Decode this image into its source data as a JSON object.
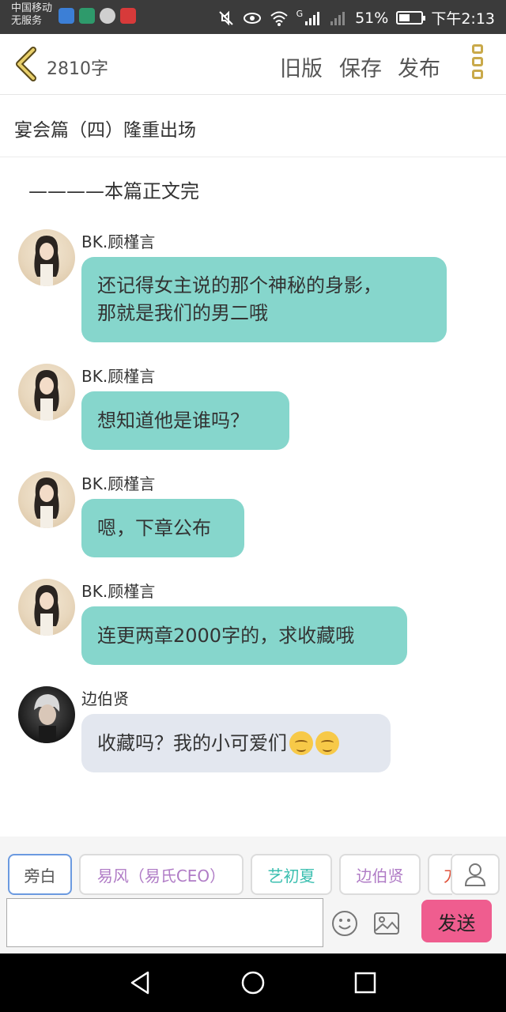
{
  "status_bar": {
    "carrier_line1": "中国移动",
    "carrier_line2": "无服务",
    "app_icons": [
      "shield-app-icon",
      "lock-app-icon",
      "wechat-icon",
      "huawei-icon"
    ],
    "network_label": "G",
    "battery_percent": "51%",
    "battery_level": 0.51,
    "time": "下午2:13"
  },
  "header": {
    "word_count": "2810字",
    "old_version": "旧版",
    "save": "保存",
    "publish": "发布"
  },
  "chapter": {
    "title": "宴会篇（四）隆重出场"
  },
  "narration": "————本篇正文完",
  "messages": [
    {
      "sender": "BK.顾槿言",
      "text": "还记得女主说的那个神秘的身影，",
      "text2": "那就是我们的男二哦"
    },
    {
      "sender": "BK.顾槿言",
      "text": "想知道他是谁吗？"
    },
    {
      "sender": "BK.顾槿言",
      "text": "嗯，下章公布"
    },
    {
      "sender": "BK.顾槿言",
      "text": "连更两章2000字的，求收藏哦"
    },
    {
      "sender": "边伯贤",
      "text": "收藏吗？我的小可爱们",
      "emojis": [
        "smirk-emoji",
        "kiss-emoji"
      ]
    }
  ],
  "roles": [
    {
      "label": "旁白",
      "color": "#555555",
      "selected": true
    },
    {
      "label": "易风（易氏CEO）",
      "color": "#b07cc6",
      "selected": false
    },
    {
      "label": "艺初夏",
      "color": "#3bbfb0",
      "selected": false
    },
    {
      "label": "边伯贤",
      "color": "#b07cc6",
      "selected": false
    },
    {
      "label": "刀",
      "color": "#e0533c",
      "selected": false
    }
  ],
  "composer": {
    "input_value": "",
    "send_label": "发送"
  },
  "colors": {
    "teal_bubble": "#86d6cc",
    "grey_bubble": "#e3e7ef",
    "send_button": "#ef5d8f",
    "accent_gold": "#c9a94a"
  }
}
